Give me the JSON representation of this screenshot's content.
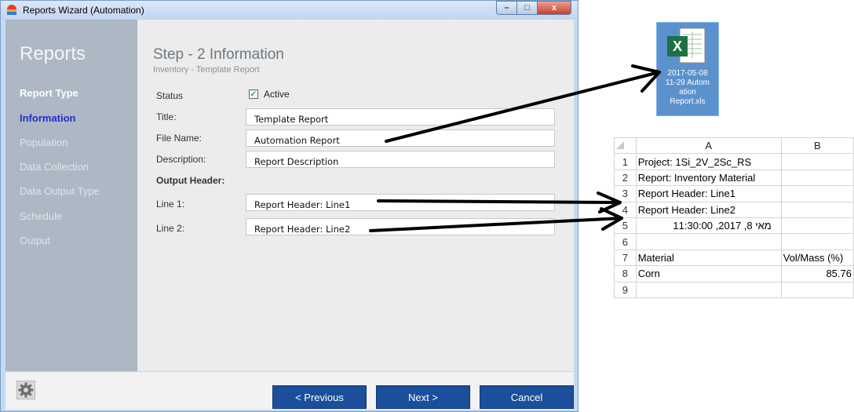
{
  "window": {
    "title": "Reports Wizard (Automation)",
    "controls": {
      "minimize": "–",
      "maximize": "□",
      "close": "x"
    }
  },
  "sidebar": {
    "title": "Reports",
    "items": [
      {
        "label": "Report Type",
        "state": "done"
      },
      {
        "label": "Information",
        "state": "active"
      },
      {
        "label": "Population",
        "state": "pending"
      },
      {
        "label": "Data Collection",
        "state": "pending"
      },
      {
        "label": "Data Output Type",
        "state": "pending"
      },
      {
        "label": "Schedule",
        "state": "pending"
      },
      {
        "label": "Output",
        "state": "pending"
      }
    ]
  },
  "main": {
    "step_title": "Step - 2  Information",
    "step_subtitle": "Inventory - Template Report",
    "status_label": "Status",
    "active_label": "Active",
    "active_checked": true,
    "title_label": "Title:",
    "title_value": "Template Report",
    "filename_label": "File Name:",
    "filename_value": "Automation Report",
    "description_label": "Description:",
    "description_value": "Report Description",
    "output_header_label": "Output Header:",
    "line1_label": "Line 1:",
    "line1_value": "Report Header: Line1",
    "line2_label": "Line 2:",
    "line2_value": "Report Header: Line2"
  },
  "footer": {
    "previous_label": "< Previous",
    "next_label": "Next >",
    "cancel_label": "Cancel"
  },
  "desktop_file": {
    "name_lines": [
      "2017-05-08",
      "11-29 Autom",
      "ation",
      "Report.xls"
    ]
  },
  "spreadsheet": {
    "columns": [
      "A",
      "B"
    ],
    "rows": [
      {
        "n": "1",
        "a": "Project: 1Si_2V_2Sc_RS",
        "b": ""
      },
      {
        "n": "2",
        "a": "Report: Inventory Material",
        "b": ""
      },
      {
        "n": "3",
        "a": "Report Header: Line1",
        "b": ""
      },
      {
        "n": "4",
        "a": "Report Header: Line2",
        "b": ""
      },
      {
        "n": "5",
        "a": "מאי 8, 2017, 11:30:00",
        "b": ""
      },
      {
        "n": "6",
        "a": "",
        "b": ""
      },
      {
        "n": "7",
        "a": "Material",
        "b": "Vol/Mass (%)"
      },
      {
        "n": "8",
        "a": "Corn",
        "b": "85.76"
      },
      {
        "n": "9",
        "a": "",
        "b": ""
      }
    ]
  },
  "colors": {
    "accent": "#1b4f9c",
    "sidebar": "#adb8c4",
    "active_nav": "#1d2fd0",
    "excel_green": "#1e7145"
  }
}
